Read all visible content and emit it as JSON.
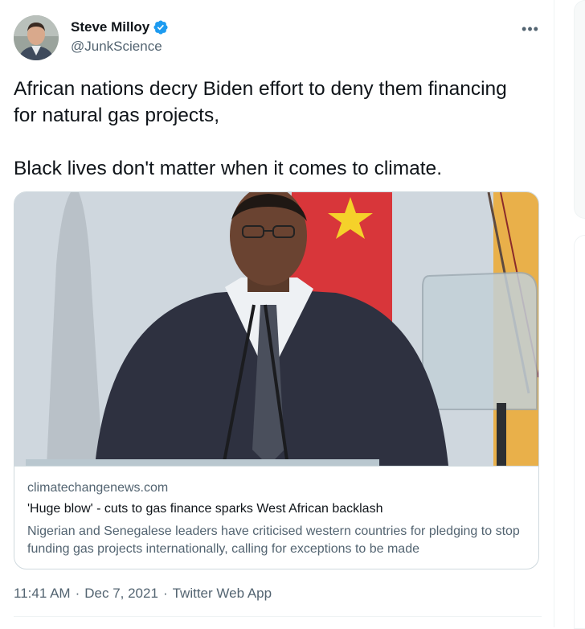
{
  "author": {
    "name": "Steve Milloy",
    "handle": "@JunkScience",
    "verified": true,
    "avatar_icon": "user-avatar"
  },
  "tweet": {
    "text": "African nations decry Biden effort to deny them financing for natural gas projects,\n\nBlack lives don't matter when it comes to climate."
  },
  "link_card": {
    "image_icon": "speaker-at-podium-photo",
    "domain": "climatechangenews.com",
    "title": "'Huge blow' - cuts to gas finance sparks West African backlash",
    "description": "Nigerian and Senegalese leaders have criticised western countries for pledging to stop funding gas projects internationally, calling for exceptions to be made"
  },
  "meta": {
    "time": "11:41 AM",
    "separator": "·",
    "date": "Dec 7, 2021",
    "source": "Twitter Web App"
  },
  "colors": {
    "text": "#0f1419",
    "secondary": "#536471",
    "verified": "#1d9bf0",
    "border": "#cfd9de"
  }
}
